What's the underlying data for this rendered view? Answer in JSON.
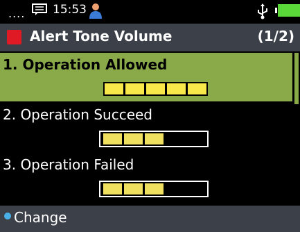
{
  "status_bar": {
    "signal": "....",
    "time": "15:53",
    "icons": [
      "message-icon",
      "user-icon",
      "usb-icon",
      "battery-icon"
    ],
    "battery_color": "#5ad83a"
  },
  "header": {
    "title": "Alert Tone Volume",
    "page_indicator": "(1/2)",
    "accent_color": "#e01a24"
  },
  "items": [
    {
      "label": "1. Operation Allowed",
      "volume": 5,
      "max_volume": 5,
      "selected": true
    },
    {
      "label": "2. Operation Succeed",
      "volume": 3,
      "max_volume": 5,
      "selected": false
    },
    {
      "label": "3. Operation Failed",
      "volume": 3,
      "max_volume": 5,
      "selected": false
    }
  ],
  "footer": {
    "softkey_label": "Change",
    "bullet_color": "#4ab0e8"
  },
  "colors": {
    "selection": "#8aaa4a",
    "volume_segment": "#f0e060",
    "bar_background": "#3c4048"
  }
}
